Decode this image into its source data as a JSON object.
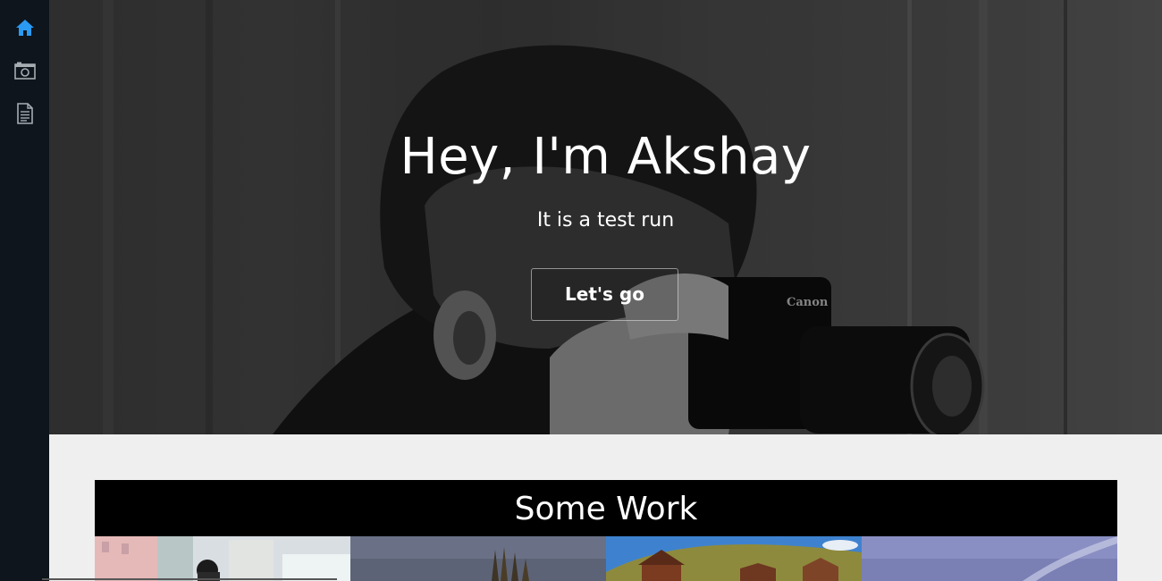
{
  "sidebar": {
    "items": [
      {
        "icon": "home-icon",
        "label": "Home",
        "active": true
      },
      {
        "icon": "camera-icon",
        "label": "Photos"
      },
      {
        "icon": "document-icon",
        "label": "Resume"
      }
    ],
    "active_color": "#2b9af3",
    "icon_color": "#a6adb3"
  },
  "hero": {
    "title": "Hey, I'm Akshay",
    "subtitle": "It is a test run",
    "button_label": "Let's go"
  },
  "work": {
    "heading": "Some Work",
    "thumbnails": [
      {
        "name": "street-photo"
      },
      {
        "name": "trees-sky-photo"
      },
      {
        "name": "houses-hill-photo"
      },
      {
        "name": "sky-photo"
      }
    ]
  }
}
